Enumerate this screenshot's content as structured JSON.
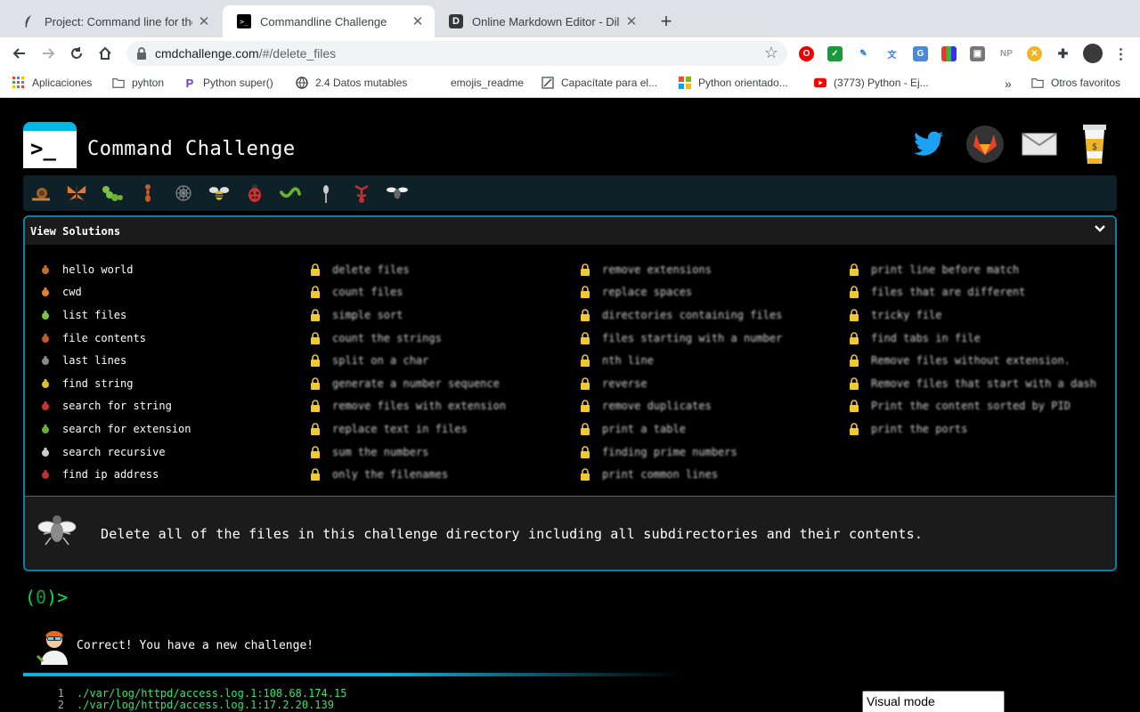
{
  "browser": {
    "tabs": [
      {
        "title": "Project: Command line for the w",
        "active": false
      },
      {
        "title": "Commandline Challenge",
        "active": true
      },
      {
        "title": "Online Markdown Editor - Dillin",
        "active": false
      }
    ],
    "url_host": "cmdchallenge.com",
    "url_path": "/#/delete_files",
    "bookmarks": [
      "Aplicaciones",
      "pyhton",
      "Python super()",
      "2.4 Datos mutables",
      "emojis_readme",
      "Capacítate para el...",
      "Python orientado...",
      "(3773) Python - Ej...",
      "Otros favoritos"
    ],
    "extension_np": "NP",
    "more_bookmarks": "»"
  },
  "header": {
    "logo_text": ">_",
    "site_title": "Command Challenge",
    "social_icons": [
      "twitter-icon",
      "gitlab-icon",
      "mail-icon",
      "coffee-icon"
    ],
    "coffee_label": "$"
  },
  "bugbar": {
    "icons": [
      "snail-icon",
      "butterfly-icon",
      "caterpillar-icon",
      "ant-icon",
      "spider-web-icon",
      "bee-icon",
      "ladybug-icon",
      "worm-icon",
      "mosquito-icon",
      "scorpion-icon",
      "fly-icon"
    ]
  },
  "panel": {
    "header_label": "View Solutions",
    "chevron": "˅",
    "columns": [
      [
        {
          "label": "hello world",
          "icon": "snail-icon",
          "color": "#c0702a"
        },
        {
          "label": "cwd",
          "icon": "butterfly-icon",
          "color": "#e08030"
        },
        {
          "label": "list files",
          "icon": "caterpillar-icon",
          "color": "#7cc242"
        },
        {
          "label": "file contents",
          "icon": "ant-icon",
          "color": "#c85a2a"
        },
        {
          "label": "last lines",
          "icon": "spider-web-icon",
          "color": "#888888"
        },
        {
          "label": "find string",
          "icon": "bee-icon",
          "color": "#e0c030"
        },
        {
          "label": "search for string",
          "icon": "ladybug-icon",
          "color": "#d03030"
        },
        {
          "label": "search for extension",
          "icon": "worm-icon",
          "color": "#6ab030"
        },
        {
          "label": "search recursive",
          "icon": "mosquito-icon",
          "color": "#cccccc"
        },
        {
          "label": "find ip address",
          "icon": "scorpion-icon",
          "color": "#c03030"
        }
      ],
      [
        {
          "label": "delete files"
        },
        {
          "label": "count files"
        },
        {
          "label": "simple sort"
        },
        {
          "label": "count the strings"
        },
        {
          "label": "split on a char"
        },
        {
          "label": "generate a number sequence"
        },
        {
          "label": "remove files with extension"
        },
        {
          "label": "replace text in files"
        },
        {
          "label": "sum the numbers"
        },
        {
          "label": "only the filenames"
        }
      ],
      [
        {
          "label": "remove extensions"
        },
        {
          "label": "replace spaces"
        },
        {
          "label": "directories containing files"
        },
        {
          "label": "files starting with a number"
        },
        {
          "label": "nth line"
        },
        {
          "label": "reverse"
        },
        {
          "label": "remove duplicates"
        },
        {
          "label": "print a table"
        },
        {
          "label": "finding prime numbers"
        },
        {
          "label": "print common lines"
        }
      ],
      [
        {
          "label": "print line before match"
        },
        {
          "label": "files that are different"
        },
        {
          "label": "tricky file"
        },
        {
          "label": "find tabs in file"
        },
        {
          "label": "Remove files without extension."
        },
        {
          "label": "Remove files that start with a dash"
        },
        {
          "label": "Print the content sorted by PID"
        },
        {
          "label": "print the ports"
        }
      ]
    ],
    "description": "Delete all of the files in this challenge directory including all subdirectories and their contents."
  },
  "prompt": {
    "open": "(",
    "count": "0",
    "close": ")>"
  },
  "result": {
    "message": "Correct! You have a new challenge!"
  },
  "output": {
    "lines": [
      {
        "n": "1",
        "text": "./var/log/httpd/access.log.1:108.68.174.15"
      },
      {
        "n": "2",
        "text": "./var/log/httpd/access.log.1:17.2.20.139"
      }
    ]
  },
  "visual_mode": {
    "label": "Visual mode"
  },
  "colors": {
    "accent": "#00b8e6",
    "panel_border": "#0b7fa8",
    "prompt_green": "#00e05a",
    "output_green": "#2ee76f"
  }
}
